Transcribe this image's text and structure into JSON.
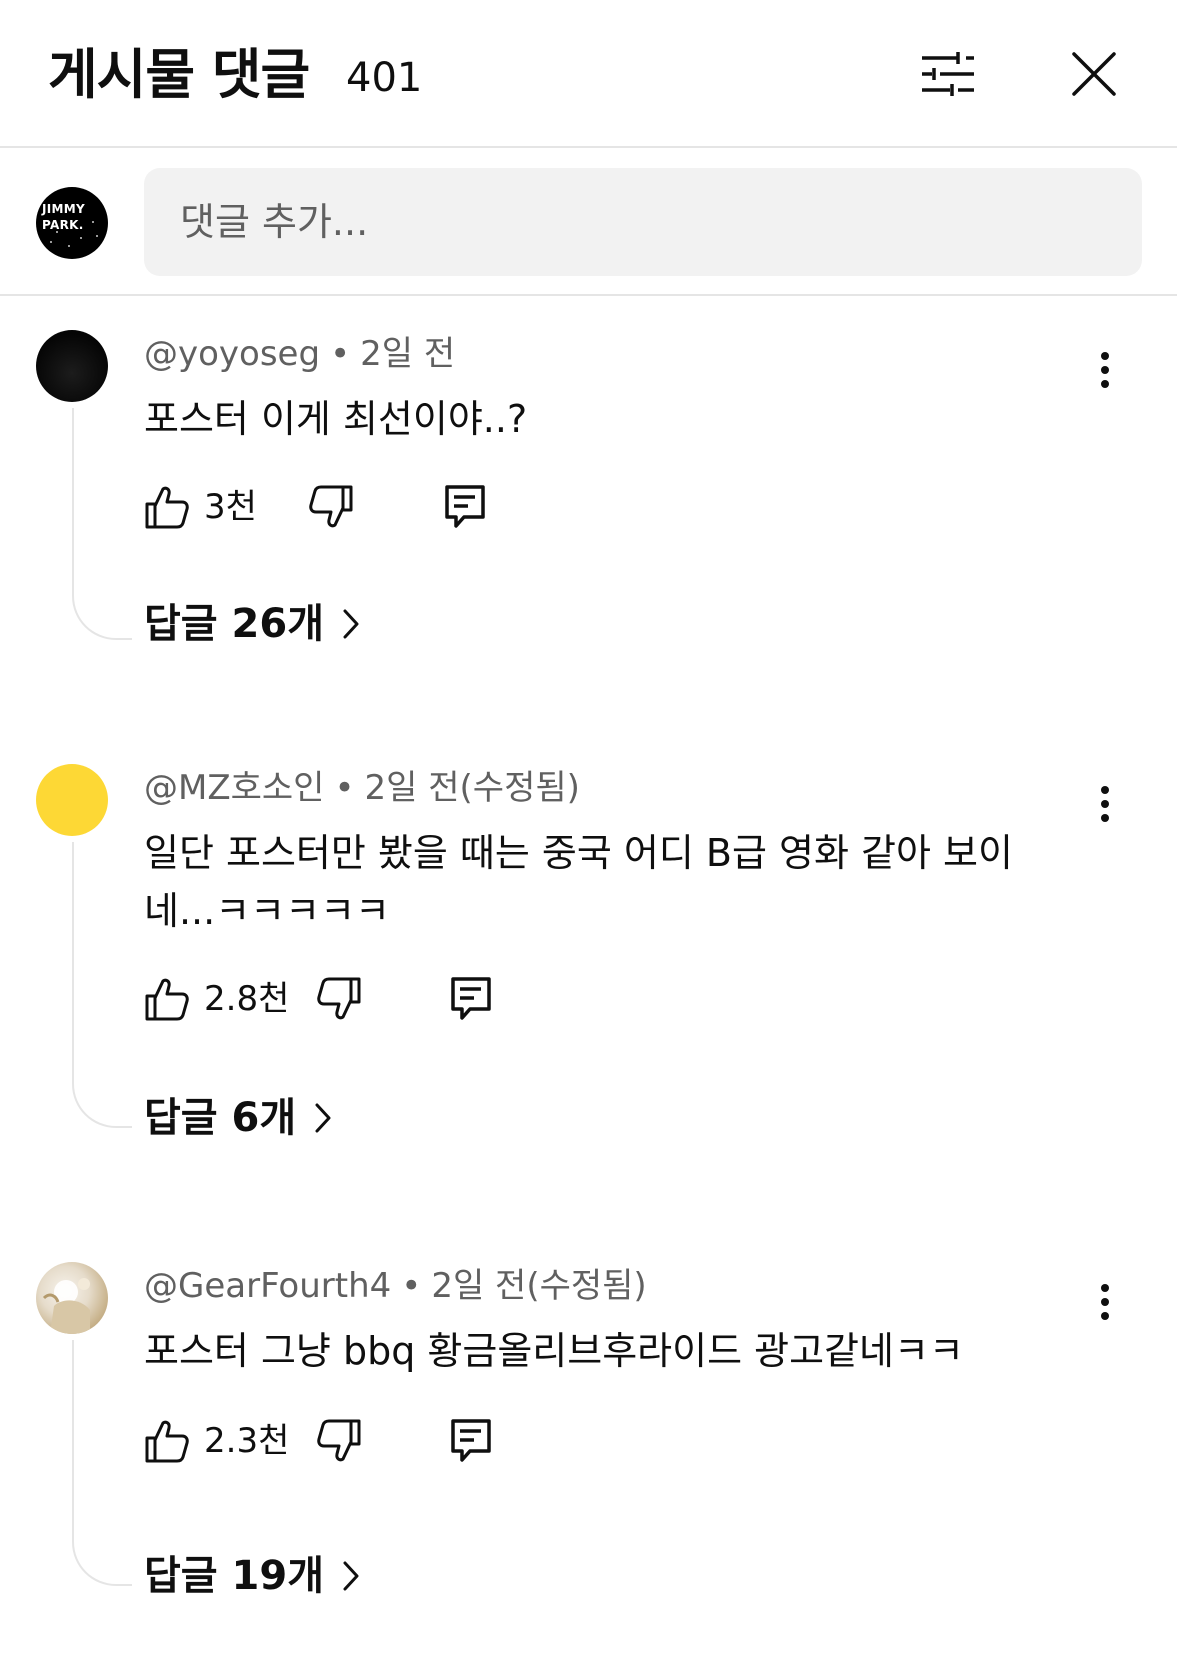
{
  "header": {
    "title": "게시물 댓글",
    "count": "401",
    "filter_icon": "sliders-icon",
    "close_icon": "close-icon"
  },
  "compose": {
    "avatar_text": "JIMMY PARK.",
    "placeholder": "댓글 추가..."
  },
  "comments": [
    {
      "author": "@yoyoseg",
      "time": "2일 전",
      "text": "포스터 이게 최선이야..?",
      "likes": "3천",
      "replies": "답글 26개",
      "avatar_color": "#0b0b0b"
    },
    {
      "author": "@MZ호소인",
      "time": "2일 전(수정됨)",
      "text": "일단 포스터만 봤을 때는 중국 어디 B급 영화 같아 보이네...ㅋㅋㅋㅋㅋ",
      "likes": "2.8천",
      "replies": "답글 6개",
      "avatar_color": "#fdd835"
    },
    {
      "author": "@GearFourth4",
      "time": "2일 전(수정됨)",
      "text": "포스터 그냥 bbq  황금올리브후라이드 광고같네ㅋㅋ",
      "likes": "2.3천",
      "replies": "답글 19개",
      "avatar_color": "#e9e2d6"
    }
  ]
}
